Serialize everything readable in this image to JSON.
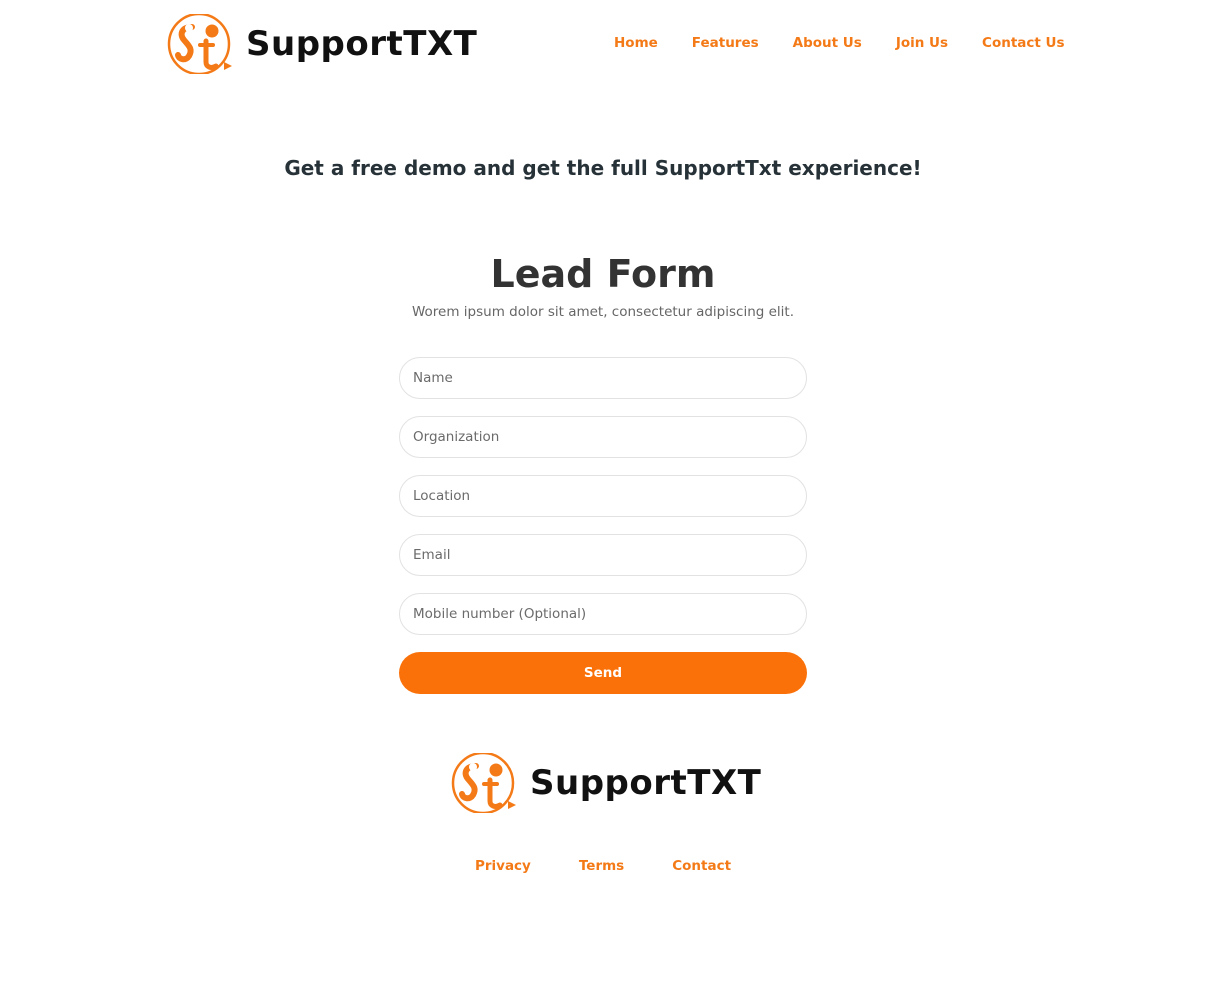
{
  "brand": {
    "name": "SupportTXT",
    "logo_color": "#f47a17"
  },
  "nav": {
    "items": [
      {
        "label": "Home"
      },
      {
        "label": "Features"
      },
      {
        "label": "About Us"
      },
      {
        "label": "Join Us"
      },
      {
        "label": "Contact Us"
      }
    ]
  },
  "tagline": "Get a free demo and get the full SupportTxt experience!",
  "form": {
    "title": "Lead Form",
    "subtitle": "Worem ipsum dolor sit amet, consectetur adipiscing elit.",
    "fields": [
      {
        "placeholder": "Name",
        "value": ""
      },
      {
        "placeholder": "Organization",
        "value": ""
      },
      {
        "placeholder": "Location",
        "value": ""
      },
      {
        "placeholder": "Email",
        "value": ""
      },
      {
        "placeholder": "Mobile number (Optional)",
        "value": ""
      }
    ],
    "submit_label": "Send",
    "submit_color": "#fb7109"
  },
  "footer": {
    "links": [
      {
        "label": "Privacy"
      },
      {
        "label": "Terms"
      },
      {
        "label": "Contact"
      }
    ]
  }
}
